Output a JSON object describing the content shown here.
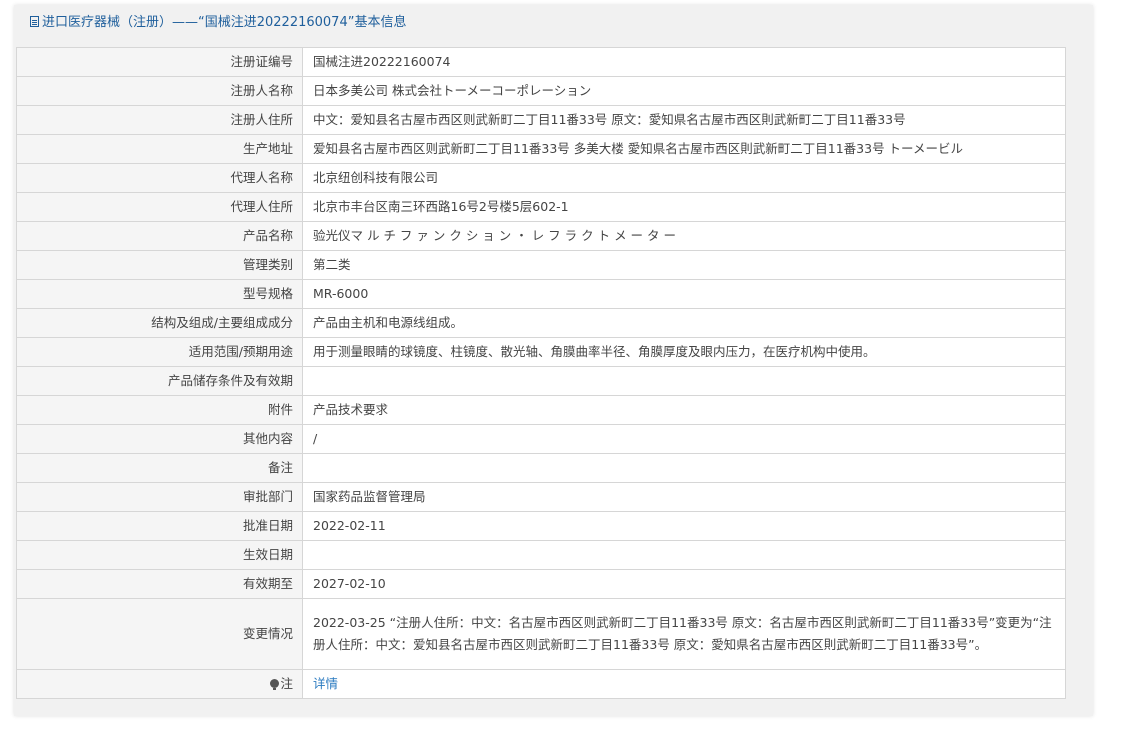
{
  "header": {
    "title": "进口医疗器械（注册）——“国械注进20222160074”基本信息"
  },
  "rows": [
    {
      "label": "注册证编号",
      "value": "国械注进20222160074"
    },
    {
      "label": "注册人名称",
      "value": "日本多美公司 株式会社トーメーコーポレーション"
    },
    {
      "label": "注册人住所",
      "value": "中文：爱知县名古屋市西区则武新町二丁目11番33号 原文：愛知県名古屋市西区則武新町二丁目11番33号"
    },
    {
      "label": "生产地址",
      "value": "爱知县名古屋市西区则武新町二丁目11番33号 多美大楼 愛知県名古屋市西区則武新町二丁目11番33号 トーメービル"
    },
    {
      "label": "代理人名称",
      "value": "北京纽创科技有限公司"
    },
    {
      "label": "代理人住所",
      "value": "北京市丰台区南三环西路16号2号楼5层602-1"
    },
    {
      "label": "产品名称",
      "value": "验光仪マ ル チ フ ァ ン ク シ ョ ン ・ レ フ ラ ク ト メ ー タ ー"
    },
    {
      "label": "管理类别",
      "value": "第二类"
    },
    {
      "label": "型号规格",
      "value": "MR-6000"
    },
    {
      "label": "结构及组成/主要组成成分",
      "value": "产品由主机和电源线组成。"
    },
    {
      "label": "适用范围/预期用途",
      "value": "用于测量眼睛的球镜度、柱镜度、散光轴、角膜曲率半径、角膜厚度及眼内压力，在医疗机构中使用。"
    },
    {
      "label": "产品储存条件及有效期",
      "value": ""
    },
    {
      "label": "附件",
      "value": "产品技术要求"
    },
    {
      "label": "其他内容",
      "value": "/"
    },
    {
      "label": "备注",
      "value": ""
    },
    {
      "label": "审批部门",
      "value": "国家药品监督管理局"
    },
    {
      "label": "批准日期",
      "value": "2022-02-11"
    },
    {
      "label": "生效日期",
      "value": ""
    },
    {
      "label": "有效期至",
      "value": "2027-02-10"
    },
    {
      "label": "变更情况",
      "value": "2022-03-25 “注册人住所：中文：名古屋市西区则武新町二丁目11番33号 原文：名古屋市西区則武新町二丁目11番33号”变更为“注册人住所：中文：爱知县名古屋市西区则武新町二丁目11番33号 原文：愛知県名古屋市西区則武新町二丁目11番33号”。"
    }
  ],
  "note": {
    "label": "注",
    "icon": "lightbulb-icon",
    "link_text": "详情"
  },
  "colors": {
    "header_text": "#1f5f9c",
    "link": "#2a7ac0",
    "label_bg": "#f5f5f5",
    "panel_bg": "#f1f1f1",
    "border": "#d6d6d6"
  }
}
